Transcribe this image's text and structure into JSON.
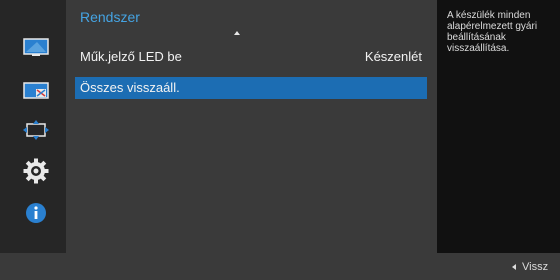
{
  "menu": {
    "title": "Rendszer",
    "items": [
      {
        "label": "Műk.jelző LED be",
        "value": "Készenlét"
      },
      {
        "label": "Összes visszaáll.",
        "value": ""
      }
    ]
  },
  "help": {
    "text": "A készülék minden alapérelmezett gyári beállításának visszaállítása."
  },
  "footer": {
    "back_label": "Vissz"
  },
  "icons": [
    "picture-icon",
    "color-icon",
    "screen-size-icon",
    "settings-gear-icon",
    "info-icon"
  ],
  "colors": {
    "accent": "#45a4e3",
    "selection": "#1c6db3",
    "panel": "#3a3a3a"
  }
}
